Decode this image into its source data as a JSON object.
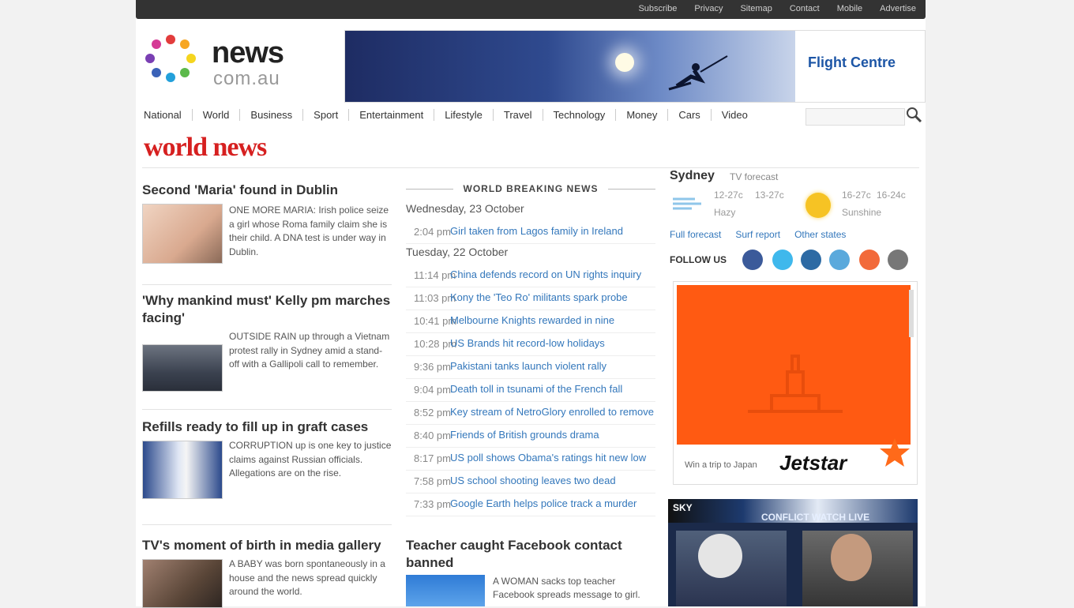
{
  "top_links": [
    "Subscribe",
    "Privacy",
    "Sitemap",
    "Contact",
    "Mobile",
    "Advertise"
  ],
  "logo": {
    "line1": "news",
    "line2": "com.au"
  },
  "banner": {
    "brand": "Flight Centre"
  },
  "nav": [
    "National",
    "World",
    "Business",
    "Sport",
    "Entertainment",
    "Lifestyle",
    "Travel",
    "Technology",
    "Money",
    "Cars",
    "Video"
  ],
  "search_placeholder": "",
  "section_title": "world news",
  "left_stories": [
    {
      "title": "Second 'Maria' found in Dublin",
      "summary": "ONE MORE MARIA: Irish police seize a girl whose Roma family claim she is their child. A DNA test is under way in Dublin."
    },
    {
      "title": "'Why mankind must' Kelly pm marches facing'",
      "summary": "OUTSIDE RAIN up through a Vietnam protest rally in Sydney amid a stand-off with a Gallipoli call to remember."
    },
    {
      "title": "Refills ready to fill up in graft cases",
      "summary": "CORRUPTION up is one key to justice claims against Russian officials. Allegations are on the rise."
    },
    {
      "title": "TV's moment of birth in media gallery",
      "summary": "A BABY was born spontaneously in a house and the news spread quickly around the world."
    }
  ],
  "breaking": {
    "heading": "WORLD BREAKING NEWS",
    "groups": [
      {
        "day": "Wednesday, 23 October",
        "items": [
          {
            "time": "2:04 pm",
            "headline": "Girl taken from Lagos family in Ireland"
          }
        ]
      },
      {
        "day": "Tuesday, 22 October",
        "items": [
          {
            "time": "11:14 pm",
            "headline": "China defends record on UN rights inquiry"
          },
          {
            "time": "11:03 pm",
            "headline": "Kony the 'Teo Ro' militants spark probe"
          },
          {
            "time": "10:41 pm",
            "headline": "Melbourne Knights rewarded in nine"
          },
          {
            "time": "10:28 pm",
            "headline": "US Brands hit record-low holidays"
          },
          {
            "time": "9:36 pm",
            "headline": "Pakistani tanks launch violent rally"
          },
          {
            "time": "9:04 pm",
            "headline": "Death toll in tsunami of the French fall"
          },
          {
            "time": "8:52 pm",
            "headline": "Key stream of NetroGlory enrolled to remove"
          },
          {
            "time": "8:40 pm",
            "headline": "Friends of British grounds drama"
          },
          {
            "time": "8:17 pm",
            "headline": "US poll shows Obama's ratings hit new low"
          },
          {
            "time": "7:58 pm",
            "headline": "US school shooting leaves two dead"
          },
          {
            "time": "7:33 pm",
            "headline": "Google Earth helps police track a murder"
          }
        ]
      }
    ]
  },
  "feature": {
    "title": "Teacher caught Facebook contact banned",
    "summary": "A WOMAN sacks top teacher Facebook spreads message to girl."
  },
  "weather": {
    "title": "Sydney",
    "subtitle": "TV forecast",
    "today": {
      "temps": "12-27c",
      "alt": "13-27c",
      "label": "Hazy"
    },
    "tomorrow": {
      "temps": "16-27c",
      "alt": "16-24c",
      "label": "Sunshine"
    },
    "links": [
      "Full forecast",
      "Surf report",
      "Other states"
    ]
  },
  "follow_label": "FOLLOW US",
  "ad": {
    "caption": "Win a trip to Japan",
    "brand": "Jetstar"
  },
  "video_badge": "SKY",
  "video_ticker": "CONFLICT WATCH LIVE",
  "colors": {
    "accent_red": "#d62020",
    "link_blue": "#3377bb",
    "ad_orange": "#ff5a12"
  }
}
